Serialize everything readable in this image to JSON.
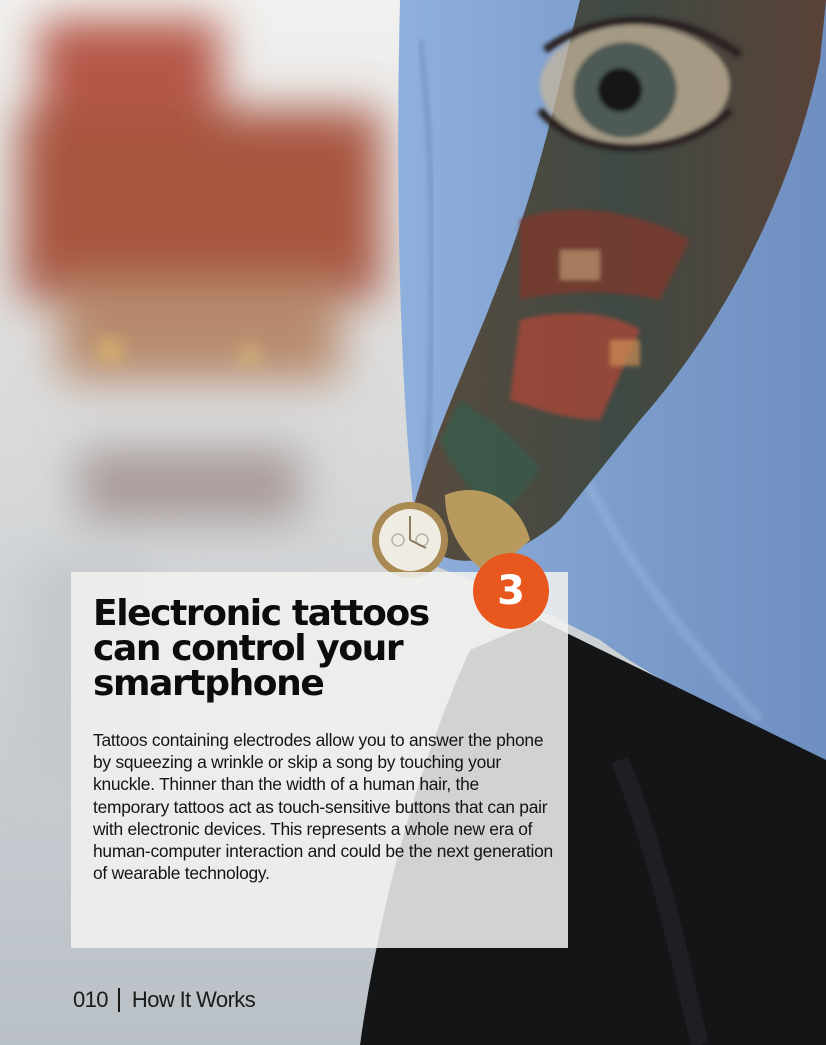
{
  "feature": {
    "number": "3",
    "headline": "Electronic tattoos can control your smartphone",
    "body": "Tattoos containing electrodes allow you to answer the phone by squeezing a wrinkle or skip a song by touching your knuckle. Thinner than the width of a human hair, the temporary tattoos act as touch-sensitive buttons that can pair with electronic devices. This represents a whole new era of human-computer interaction and could be the next generation of wearable technology."
  },
  "folio": {
    "page_number": "010",
    "publication": "How It Works"
  },
  "colors": {
    "badge": "#e8571d",
    "shirt": "#7f9fcd",
    "card": "#f2f2f0"
  },
  "image": {
    "subject": "tattooed-forearm-with-gold-watch"
  }
}
